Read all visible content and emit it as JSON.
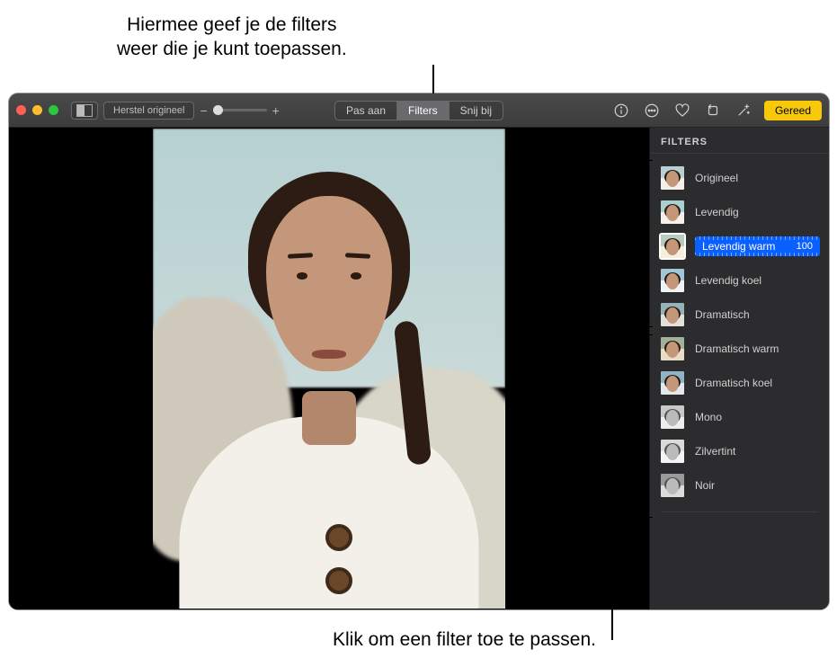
{
  "callouts": {
    "top": "Hiermee geef je de filters\nweer die je kunt toepassen.",
    "bottom": "Klik om een filter toe te passen."
  },
  "toolbar": {
    "restore": "Herstel origineel",
    "segments": {
      "adjust": "Pas aan",
      "filters": "Filters",
      "crop": "Snij bij"
    },
    "done": "Gereed"
  },
  "panel": {
    "title": "FILTERS",
    "filters": [
      {
        "label": "Origineel",
        "sky": "#b7d1d2",
        "shirt": "#f3efe9",
        "mono": false,
        "selected": false
      },
      {
        "label": "Levendig",
        "sky": "#a9cfd0",
        "shirt": "#f6f2ea",
        "mono": false,
        "selected": false
      },
      {
        "label": "Levendig warm",
        "sky": "#b5ccbf",
        "shirt": "#f8eedd",
        "mono": false,
        "selected": true,
        "value": "100"
      },
      {
        "label": "Levendig koel",
        "sky": "#a0c8d9",
        "shirt": "#eef3f6",
        "mono": false,
        "selected": false
      },
      {
        "label": "Dramatisch",
        "sky": "#93b3b8",
        "shirt": "#e4e2d8",
        "mono": false,
        "selected": false
      },
      {
        "label": "Dramatisch warm",
        "sky": "#a2b19a",
        "shirt": "#eaddc8",
        "mono": false,
        "selected": false
      },
      {
        "label": "Dramatisch koel",
        "sky": "#8fb4c5",
        "shirt": "#e2e8ec",
        "mono": false,
        "selected": false
      },
      {
        "label": "Mono",
        "sky": "#c9c9c9",
        "shirt": "#ededed",
        "mono": true,
        "selected": false
      },
      {
        "label": "Zilvertint",
        "sky": "#dadada",
        "shirt": "#f4f4f4",
        "mono": true,
        "selected": false
      },
      {
        "label": "Noir",
        "sky": "#9a9a9a",
        "shirt": "#dcdcdc",
        "mono": true,
        "selected": false
      }
    ]
  }
}
